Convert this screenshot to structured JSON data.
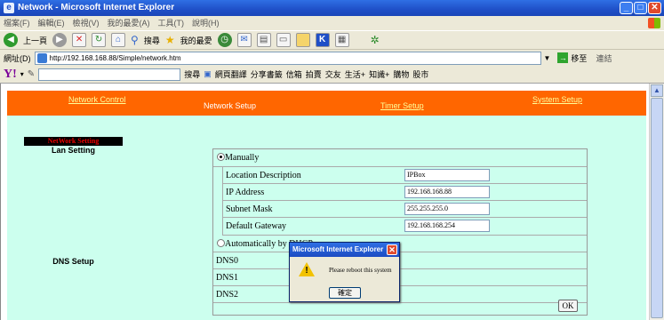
{
  "window": {
    "title": "Network - Microsoft Internet Explorer"
  },
  "menu": [
    "檔案(F)",
    "編輯(E)",
    "檢視(V)",
    "我的最愛(A)",
    "工具(T)",
    "說明(H)"
  ],
  "toolbar": {
    "back": "上一頁",
    "search": "搜尋",
    "favorites": "我的最愛"
  },
  "address": {
    "label": "網址(D)",
    "url": "http://192.168.168.88/Simple/network.htm",
    "go": "移至",
    "links": "連結"
  },
  "searchbar": {
    "search": "搜尋",
    "items": [
      "網頁翻譯",
      "分享書籤",
      "信箱",
      "拍賣",
      "交友",
      "生活+",
      "知識+",
      "購物",
      "股市"
    ]
  },
  "nav": {
    "network_control": "Network Control",
    "network_setup": "Network Setup",
    "timer_setup": "Timer Setup",
    "system_setup": "System Setup"
  },
  "sidebar": {
    "header": "NetWork Setting",
    "lan": "Lan Setting",
    "dns": "DNS Setup"
  },
  "form": {
    "manual_label": "Manually",
    "location_label": "Location Description",
    "location_value": "IPBox",
    "ip_label": "IP Address",
    "ip_value": "192.168.168.88",
    "mask_label": "Subnet Mask",
    "mask_value": "255.255.255.0",
    "gateway_label": "Default Gateway",
    "gateway_value": "192.168.168.254",
    "auto_label": "Automatically by DHCP",
    "dns0": "DNS0",
    "dns1": "DNS1",
    "dns2": "DNS2",
    "ok": "OK"
  },
  "dialog": {
    "title": "Microsoft Internet Explorer",
    "message": "Please reboot this system",
    "ok": "確定"
  }
}
